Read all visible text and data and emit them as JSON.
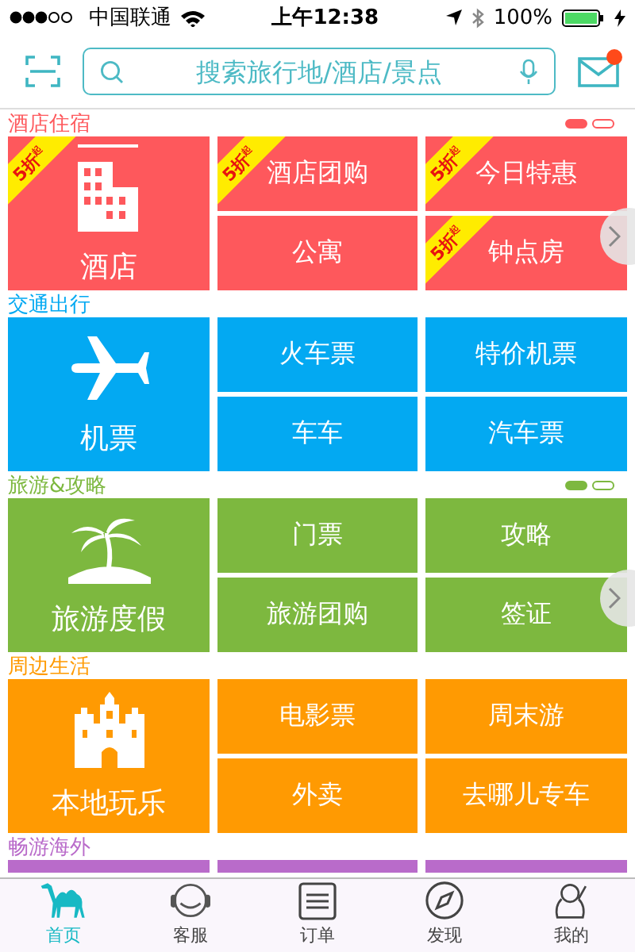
{
  "status_bar": {
    "carrier": "中国联通",
    "time": "上午12:38",
    "battery": "100%"
  },
  "header": {
    "search": {
      "placeholder": "搜索旅行地/酒店/景点"
    },
    "mail": {
      "unread": true
    }
  },
  "sections": [
    {
      "title": "酒店住宿",
      "color": "#fe585c",
      "pages": [
        {
          "selected": true
        },
        {
          "selected": false
        }
      ],
      "big": {
        "label": "酒店",
        "badge": "5折$^{起}$"
      },
      "tiles": [
        {
          "label": "酒店团购",
          "badge": "5折$^{起}$"
        },
        {
          "label": "今日特惠",
          "badge": "5折$^{起}$"
        },
        {
          "label": "公寓"
        },
        {
          "label": "钟点房",
          "badge": "5折$^{起}$"
        }
      ]
    },
    {
      "title": "交通出行",
      "color": "#03a9f2",
      "big": {
        "label": "机票"
      },
      "tiles": [
        {
          "label": "火车票"
        },
        {
          "label": "特价机票"
        },
        {
          "label": "车车"
        },
        {
          "label": "汽车票"
        }
      ]
    },
    {
      "title": "旅游&攻略",
      "color": "#7db83f",
      "pages": [
        {
          "selected": true
        },
        {
          "selected": false
        }
      ],
      "big": {
        "label": "旅游度假"
      },
      "tiles": [
        {
          "label": "门票"
        },
        {
          "label": "攻略"
        },
        {
          "label": "旅游团购"
        },
        {
          "label": "签证"
        }
      ]
    },
    {
      "title": "周边生活",
      "color": "#ff9a02",
      "big": {
        "label": "本地玩乐"
      },
      "tiles": [
        {
          "label": "电影票"
        },
        {
          "label": "周末游"
        },
        {
          "label": "外卖"
        },
        {
          "label": "去哪儿专车"
        }
      ]
    },
    {
      "title": "畅游海外",
      "color": "#b96bca"
    }
  ],
  "tab_bar": [
    {
      "label": "首页",
      "selected": true
    },
    {
      "label": "客服",
      "selected": false
    },
    {
      "label": "订单",
      "selected": false
    },
    {
      "label": "发现",
      "selected": false
    },
    {
      "label": "我的",
      "selected": false
    }
  ]
}
